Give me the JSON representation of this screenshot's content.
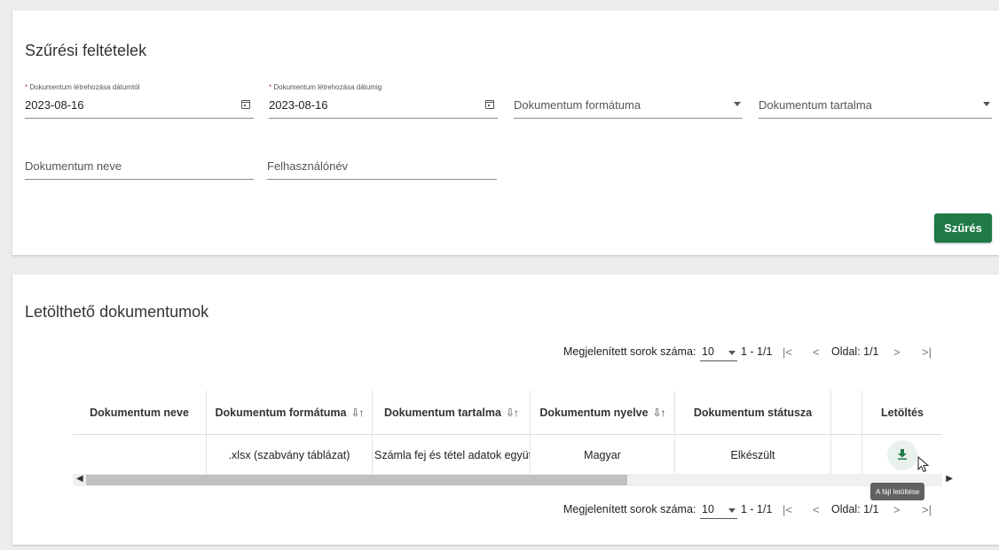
{
  "filter": {
    "title": "Szűrési feltételek",
    "date_from": {
      "label": "Dokumentum létrehozása dátumtól",
      "required_mark": "*",
      "value": "2023-08-16"
    },
    "date_to": {
      "label": "Dokumentum létrehozása dátumig",
      "required_mark": "*",
      "value": "2023-08-16"
    },
    "format_placeholder": "Dokumentum formátuma",
    "content_placeholder": "Dokumentum tartalma",
    "name_placeholder": "Dokumentum neve",
    "username_placeholder": "Felhasználónév",
    "filter_button": "Szűrés"
  },
  "documents": {
    "title": "Letölthető dokumentumok",
    "pager": {
      "rows_label": "Megjelenített sorok száma:",
      "rows_value": "10",
      "range": "1 - 1/1",
      "first": "|<",
      "prev": "<",
      "page": "Oldal: 1/1",
      "next": ">",
      "last": ">|"
    },
    "columns": [
      "Dokumentum neve",
      "Dokumentum formátuma",
      "Dokumentum tartalma",
      "Dokumentum nyelve",
      "Dokumentum státusza",
      "",
      "Letöltés"
    ],
    "rows": [
      {
        "name": "",
        "format": ".xlsx (szabvány táblázat)",
        "content": "Számla fej és tétel adatok együtt",
        "language": "Magyar",
        "status": "Elkészült",
        "extra": ""
      }
    ],
    "download_tooltip": "A fájl letöltése"
  },
  "colors": {
    "primary_green": "#1f7a46",
    "required_red": "#d32f2f",
    "tooltip_bg": "#616161"
  },
  "icons": {
    "calendar": "calendar-icon",
    "dropdown": "chevron-down-icon",
    "sort": "sort-icon",
    "download": "download-icon"
  }
}
